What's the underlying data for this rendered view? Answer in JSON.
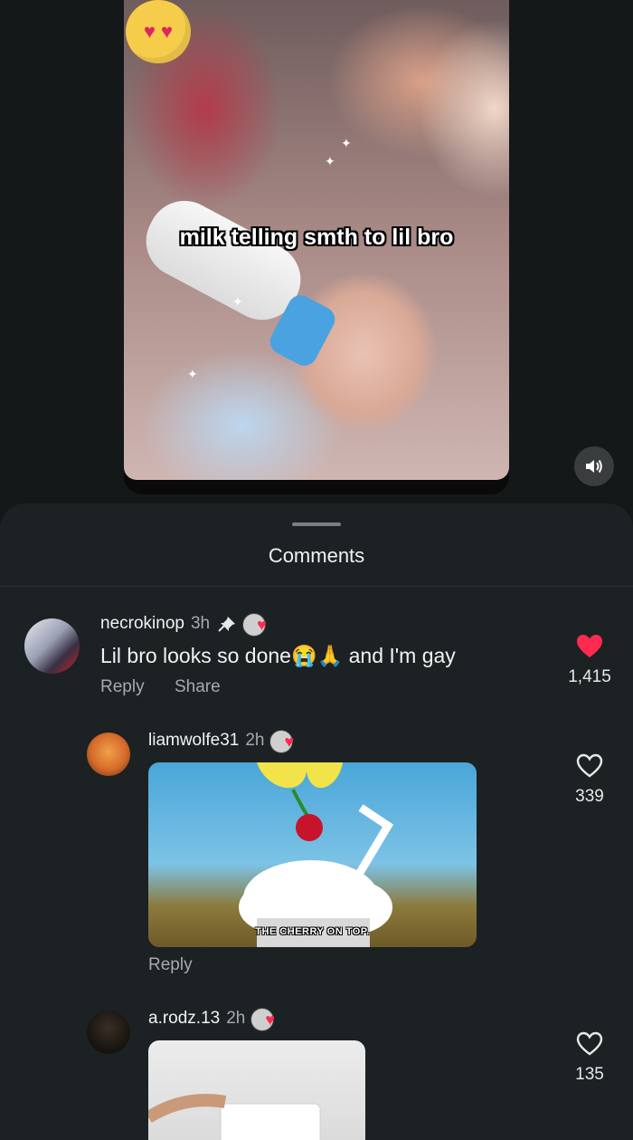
{
  "video": {
    "caption": "milk telling smth to lil bro",
    "sound_icon": "speaker-icon"
  },
  "comments_sheet": {
    "title": "Comments",
    "comments": [
      {
        "username": "necrokinop",
        "time": "3h",
        "pinned": true,
        "text": "Lil bro looks so done😭🙏 and I'm gay",
        "reply_label": "Reply",
        "share_label": "Share",
        "likes": "1,415",
        "liked": true
      },
      {
        "username": "liamwolfe31",
        "time": "2h",
        "gif_caption": "THE CHERRY ON TOP.",
        "reply_label": "Reply",
        "likes": "339",
        "liked": false
      },
      {
        "username": "a.rodz.13",
        "time": "2h",
        "likes": "135",
        "liked": false
      }
    ]
  },
  "colors": {
    "background": "#141819",
    "sheet": "#1c2124",
    "like_red": "#ff2a4f",
    "muted_text": "#a7aaad"
  }
}
